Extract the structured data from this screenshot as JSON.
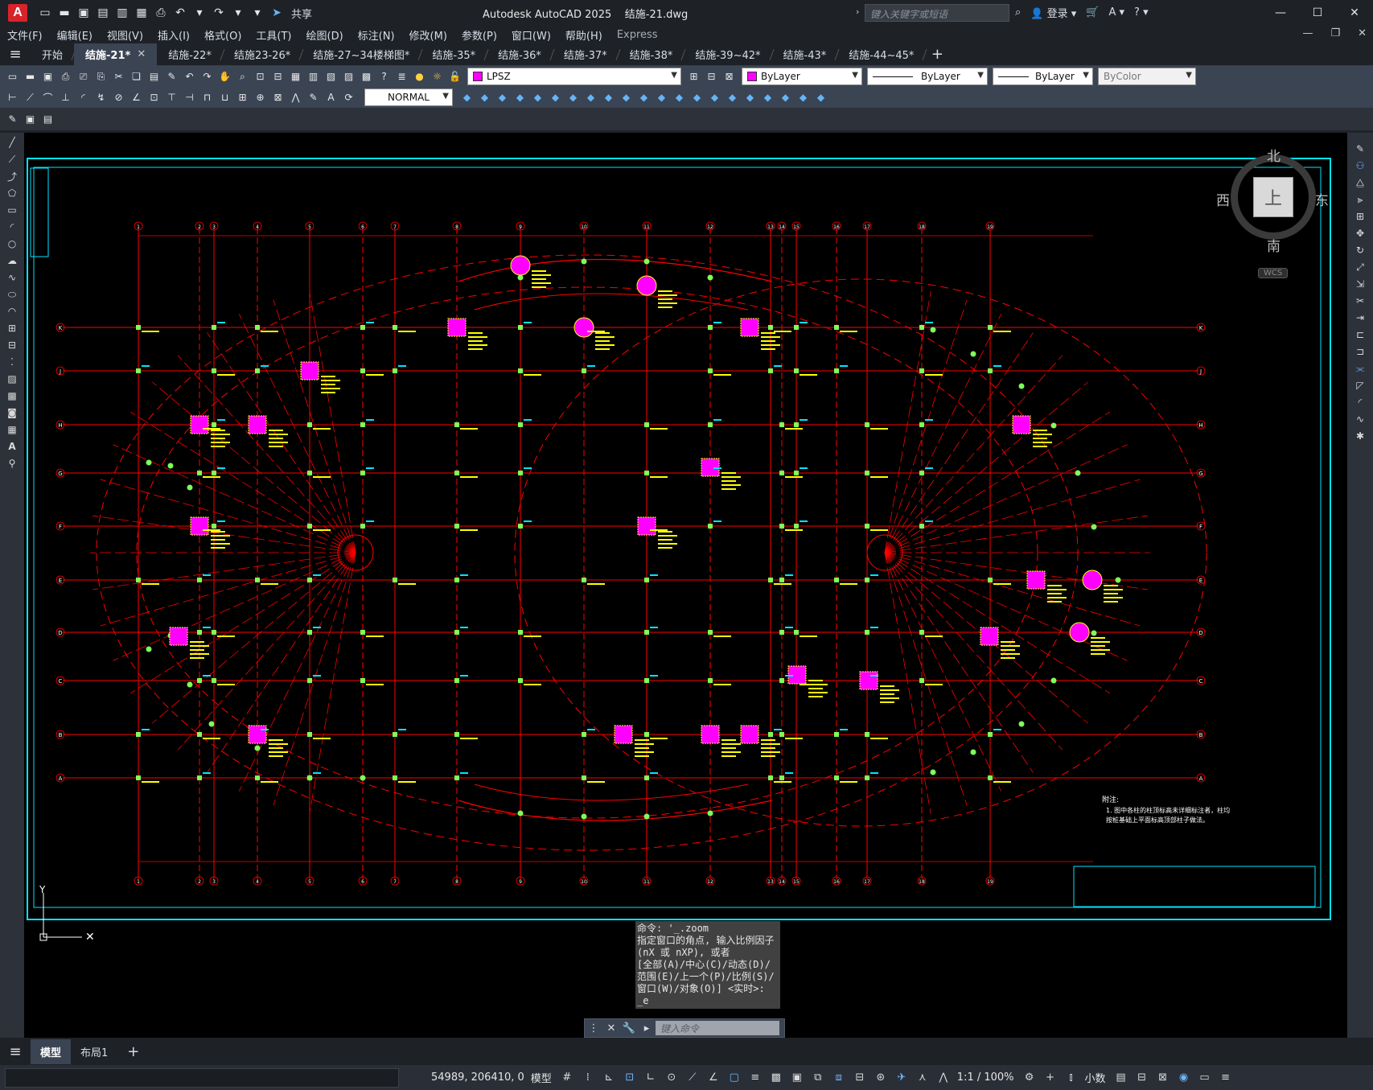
{
  "app": {
    "logo": "A",
    "title": "Autodesk AutoCAD 2025",
    "filename": "结施-21.dwg",
    "share_label": "共享",
    "search_placeholder": "键入关键字或短语",
    "login_label": "登录"
  },
  "menu": [
    "文件(F)",
    "编辑(E)",
    "视图(V)",
    "插入(I)",
    "格式(O)",
    "工具(T)",
    "绘图(D)",
    "标注(N)",
    "修改(M)",
    "参数(P)",
    "窗口(W)",
    "帮助(H)",
    "Express"
  ],
  "tabs": [
    {
      "label": "开始",
      "active": false
    },
    {
      "label": "结施-21*",
      "active": true
    },
    {
      "label": "结施-22*",
      "active": false
    },
    {
      "label": "结施23-26*",
      "active": false
    },
    {
      "label": "结施-27~34楼梯图*",
      "active": false
    },
    {
      "label": "结施-35*",
      "active": false
    },
    {
      "label": "结施-36*",
      "active": false
    },
    {
      "label": "结施-37*",
      "active": false
    },
    {
      "label": "结施-38*",
      "active": false
    },
    {
      "label": "结施-39~42*",
      "active": false
    },
    {
      "label": "结施-43*",
      "active": false
    },
    {
      "label": "结施-44~45*",
      "active": false
    }
  ],
  "layer": {
    "name": "LPSZ"
  },
  "properties": {
    "color": "ByLayer",
    "linetype": "ByLayer",
    "lineweight": "ByLayer",
    "plotstyle": "ByColor"
  },
  "dimstyle": "NORMAL",
  "viewcube": {
    "north": "北",
    "south": "南",
    "east": "东",
    "west": "西",
    "face": "上",
    "wcs": "WCS"
  },
  "grid": {
    "columns": [
      "1",
      "2",
      "3",
      "4",
      "5",
      "6",
      "7",
      "8",
      "9",
      "10",
      "11",
      "12",
      "13",
      "14",
      "15",
      "16",
      "17",
      "18",
      "19"
    ],
    "rows": [
      "K",
      "J",
      "H",
      "G",
      "F",
      "E",
      "D",
      "C",
      "B",
      "A"
    ]
  },
  "notes": {
    "heading": "附注:",
    "line1": "1. 图中各柱的柱顶标高未详细标注者，柱均",
    "line2": "按桩基础上平面标高顶部柱子做法。"
  },
  "command": {
    "history": [
      "命令: '_.zoom",
      "指定窗口的角点, 输入比例因子 (nX 或 nXP), 或者",
      "[全部(A)/中心(C)/动态(D)/范围(E)/上一个(P)/比例(S)/窗口(W)/对象(O)] <实时>:",
      "_e"
    ],
    "placeholder": "键入命令"
  },
  "layout_tabs": [
    {
      "label": "模型",
      "active": true
    },
    {
      "label": "布局1",
      "active": false
    }
  ],
  "status": {
    "coords": "54989, 206410, 0",
    "model": "模型",
    "scale": "1:1 / 100%",
    "units": "小数"
  },
  "colors": {
    "grid_line": "#ff0000",
    "frame": "#00e5ff",
    "column_fill": "#ff00ff",
    "text": "#ffff00",
    "node": "#7dff5a"
  }
}
